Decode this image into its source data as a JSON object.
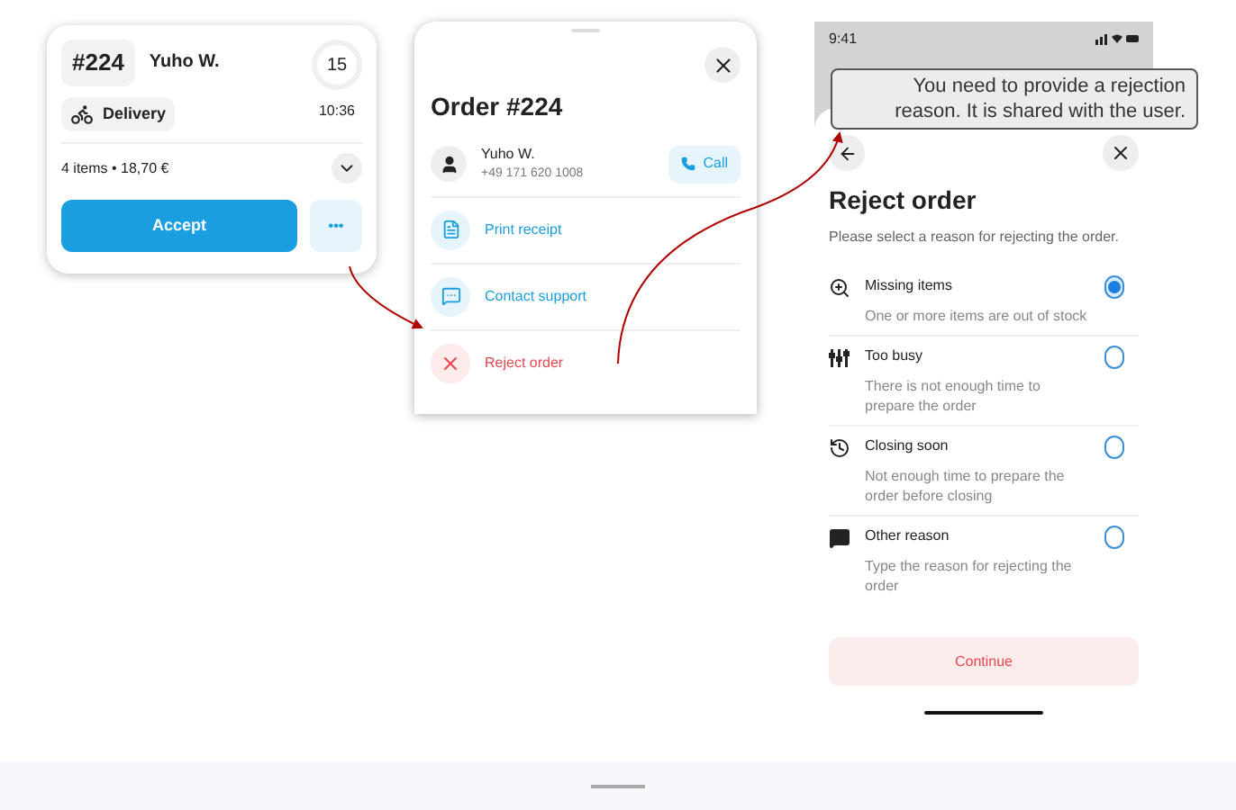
{
  "order_card": {
    "number": "#224",
    "customer": "Yuho W.",
    "type": "Delivery",
    "minutes": "15",
    "time": "10:36",
    "summary": "4 items • 18,70 €",
    "accept": "Accept",
    "more": "•••"
  },
  "order_sheet": {
    "title": "Order #224",
    "customer": "Yuho W.",
    "phone": "+49 171 620 1008",
    "call": "Call",
    "actions": [
      {
        "kind": "print",
        "label": "Print receipt",
        "danger": false
      },
      {
        "kind": "support",
        "label": "Contact support",
        "danger": false
      },
      {
        "kind": "reject",
        "label": "Reject order",
        "danger": true
      }
    ]
  },
  "reject_screen": {
    "status_time": "9:41",
    "title": "Reject order",
    "subtitle": "Please select a reason for rejecting the order.",
    "reasons": [
      {
        "kind": "search",
        "label": "Missing items",
        "description": "One or more items are out of stock",
        "selected": true
      },
      {
        "kind": "busy",
        "label": "Too busy",
        "description": "There is not enough time to prepare the order",
        "selected": false
      },
      {
        "kind": "clock",
        "label": "Closing soon",
        "description": "Not enough time to prepare the order before closing",
        "selected": false
      },
      {
        "kind": "message",
        "label": "Other reason",
        "description": "Type the reason for rejecting the order",
        "selected": false
      }
    ],
    "continue": "Continue"
  },
  "callout": {
    "text": "You need to provide a rejection reason. It is shared with the user."
  }
}
